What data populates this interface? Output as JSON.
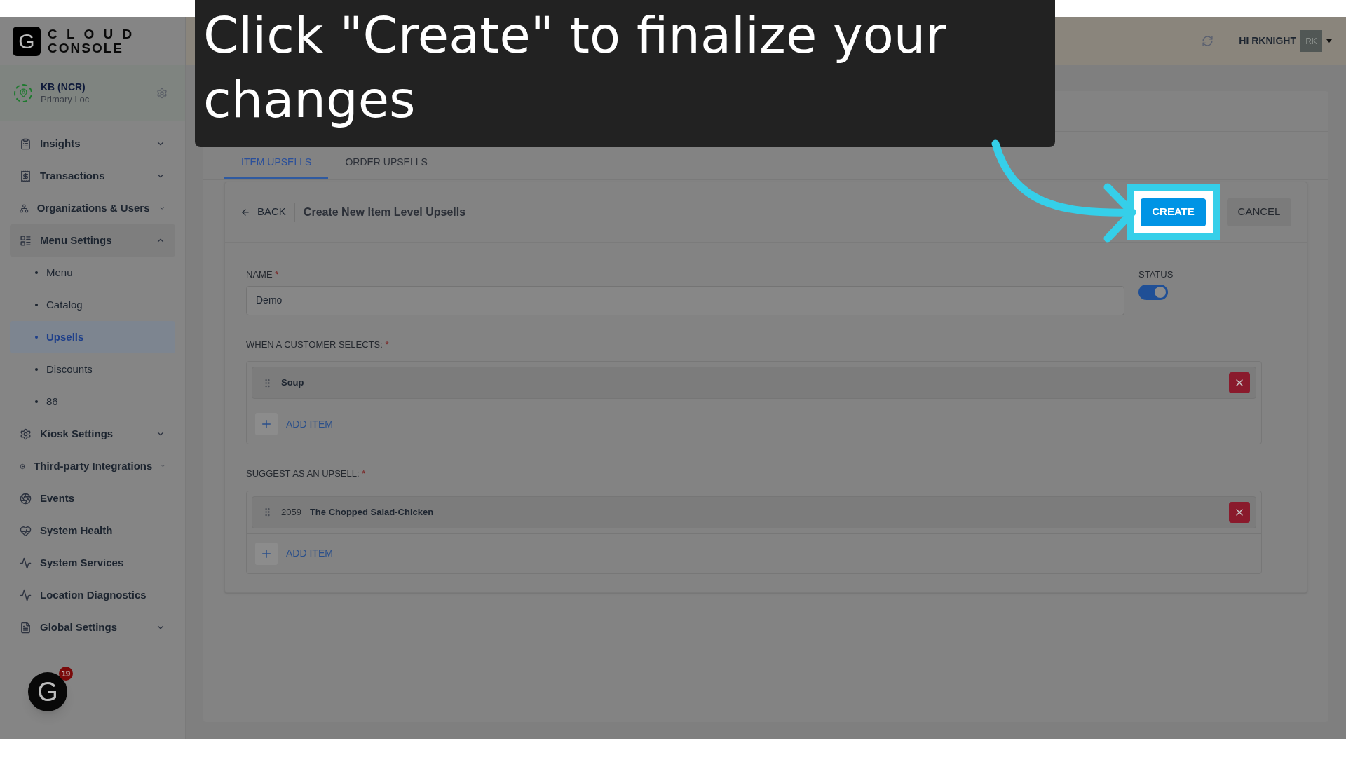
{
  "overlay": {
    "text": "Click \"Create\" to finalize your changes"
  },
  "logo": {
    "mark": "G",
    "line1": "C L O U D",
    "line2": "CONSOLE"
  },
  "location": {
    "name": "KB (NCR)",
    "sub": "Primary Loc"
  },
  "sidebar": {
    "items": [
      {
        "label": "Insights",
        "expanded": false
      },
      {
        "label": "Transactions",
        "expanded": false
      },
      {
        "label": "Organizations & Users",
        "expanded": false
      },
      {
        "label": "Menu Settings",
        "expanded": true,
        "children": [
          {
            "label": "Menu",
            "selected": false
          },
          {
            "label": "Catalog",
            "selected": false
          },
          {
            "label": "Upsells",
            "selected": true
          },
          {
            "label": "Discounts",
            "selected": false
          },
          {
            "label": "86",
            "selected": false
          }
        ]
      },
      {
        "label": "Kiosk Settings",
        "expanded": false
      },
      {
        "label": "Third-party Integrations",
        "expanded": false
      },
      {
        "label": "Events"
      },
      {
        "label": "System Health"
      },
      {
        "label": "System Services"
      },
      {
        "label": "Location Diagnostics"
      },
      {
        "label": "Global Settings",
        "expanded": false
      }
    ]
  },
  "help_badge": {
    "mark": "G",
    "count": "19"
  },
  "topbar": {
    "greeting": "HI RKNIGHT",
    "avatar": "RK"
  },
  "tabs": [
    {
      "label": "ITEM UPSELLS",
      "selected": true
    },
    {
      "label": "ORDER UPSELLS",
      "selected": false
    }
  ],
  "form_header": {
    "back": "BACK",
    "title": "Create New Item Level Upsells",
    "create": "CREATE",
    "cancel": "CANCEL",
    "create_highlighted": true
  },
  "name_field": {
    "label": "NAME",
    "required": "*",
    "value": "Demo"
  },
  "status": {
    "label": "STATUS",
    "on": true
  },
  "sections": [
    {
      "label": "WHEN A CUSTOMER SELECTS:",
      "required": "*",
      "items": [
        {
          "name": "Soup"
        }
      ],
      "add": "ADD ITEM"
    },
    {
      "label": "SUGGEST AS AN UPSELL:",
      "required": "*",
      "items": [
        {
          "code": "2059",
          "name": "The Chopped Salad-Chicken"
        }
      ],
      "add": "ADD ITEM"
    }
  ]
}
